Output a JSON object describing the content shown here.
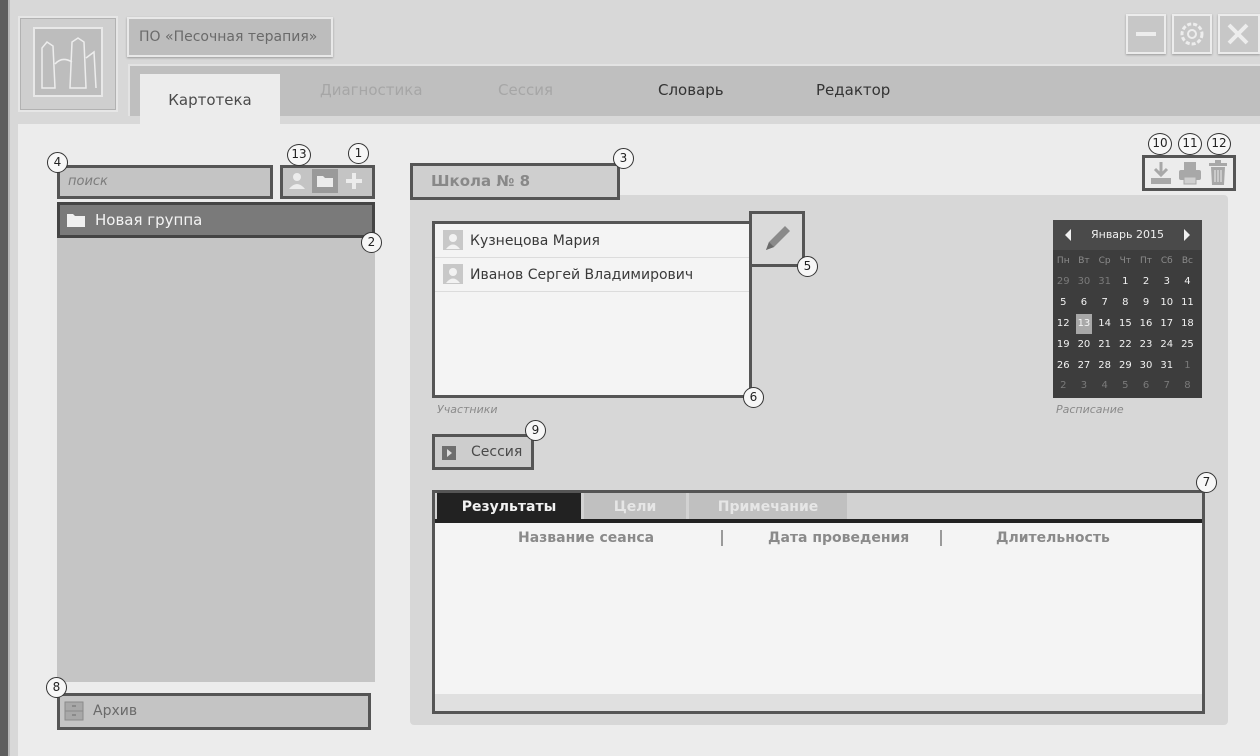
{
  "app": {
    "title": "ПО «Песочная терапия»"
  },
  "tabs": [
    {
      "label": "Картотека",
      "state": "active"
    },
    {
      "label": "Диагностика",
      "state": "disabled"
    },
    {
      "label": "Сессия",
      "state": "disabled"
    },
    {
      "label": "Словарь",
      "state": "normal"
    },
    {
      "label": "Редактор",
      "state": "normal"
    }
  ],
  "left_panel": {
    "search_placeholder": "поиск",
    "groups": [
      {
        "label": "Новая группа",
        "icon": "folder-icon"
      }
    ],
    "archive_label": "Архив",
    "tools": [
      "person-icon",
      "folder-icon",
      "plus-icon"
    ]
  },
  "right_panel": {
    "group_title": "Школа № 8",
    "participants": [
      {
        "name": "Кузнецова Мария",
        "icon": "person-icon"
      },
      {
        "name": "Иванов Сергей Владимирович",
        "icon": "person-icon"
      }
    ],
    "participants_caption": "Участники",
    "schedule_caption": "Расписание",
    "session_button": "Сессия",
    "action_icons": [
      "download-icon",
      "print-icon",
      "trash-icon"
    ]
  },
  "calendar": {
    "month_label": "Январь 2015",
    "weekdays": [
      "Пн",
      "Вт",
      "Ср",
      "Чт",
      "Пт",
      "Сб",
      "Вс"
    ],
    "days": [
      [
        "29",
        "30",
        "31",
        "1",
        "2",
        "3",
        "4"
      ],
      [
        "5",
        "6",
        "7",
        "8",
        "9",
        "10",
        "11"
      ],
      [
        "12",
        "13",
        "14",
        "15",
        "16",
        "17",
        "18"
      ],
      [
        "19",
        "20",
        "21",
        "22",
        "23",
        "24",
        "25"
      ],
      [
        "26",
        "27",
        "28",
        "29",
        "30",
        "31",
        "1"
      ],
      [
        "2",
        "3",
        "4",
        "5",
        "6",
        "7",
        "8"
      ]
    ],
    "selected_day": "13"
  },
  "results": {
    "tabs": [
      {
        "label": "Результаты",
        "state": "active"
      },
      {
        "label": "Цели",
        "state": "inactive"
      },
      {
        "label": "Примечание",
        "state": "inactive"
      }
    ],
    "columns": [
      "Название сеанса",
      "Дата проведения",
      "Длительность"
    ]
  },
  "callouts": [
    "1",
    "2",
    "3",
    "4",
    "5",
    "6",
    "7",
    "8",
    "9",
    "10",
    "11",
    "12",
    "13"
  ],
  "colors": {
    "frame": "#d8d8d8",
    "panel": "#ececec",
    "highlight_border": "#555555",
    "calendar_bg": "#3d3d3d"
  }
}
